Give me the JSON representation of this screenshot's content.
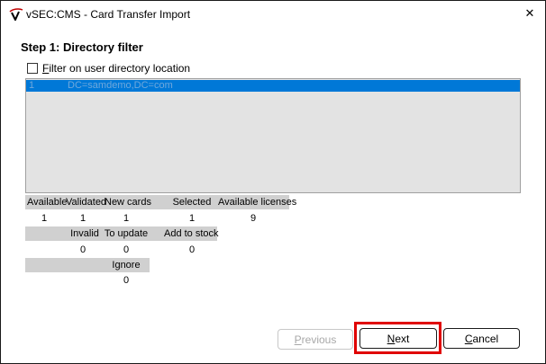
{
  "window": {
    "title": "vSEC:CMS - Card Transfer Import",
    "logo_icon": "vsec-logo-icon",
    "close_icon": "close-icon",
    "close_glyph": "✕"
  },
  "step": {
    "title": "Step 1: Directory filter"
  },
  "filter": {
    "checked": false,
    "mnemonic": "F",
    "label_rest": "ilter on user directory location"
  },
  "directory_list": {
    "selection_color": "#0078d7",
    "rows": [
      {
        "index": "1",
        "name": "DC=samdemo,DC=com",
        "selected": true
      }
    ]
  },
  "stats": {
    "row1_headers": [
      "Available",
      "Validated",
      "New cards",
      "Selected",
      "Available licenses"
    ],
    "row1_values": [
      "1",
      "1",
      "1",
      "1",
      "9"
    ],
    "row2_headers": [
      "Invalid",
      "To update",
      "Add to stock"
    ],
    "row2_values": [
      "0",
      "0",
      "0"
    ],
    "row3_headers": [
      "Ignore"
    ],
    "row3_values": [
      "0"
    ]
  },
  "buttons": {
    "previous": {
      "mnemonic": "P",
      "rest": "revious",
      "enabled": false
    },
    "next": {
      "mnemonic": "N",
      "rest": "ext",
      "enabled": true
    },
    "cancel": {
      "mnemonic": "C",
      "rest": "ancel",
      "enabled": true
    }
  },
  "annotation": {
    "highlight_color": "#e00000",
    "target": "next-button"
  }
}
